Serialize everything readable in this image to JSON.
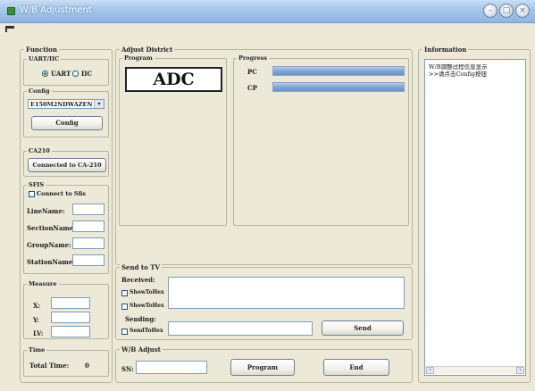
{
  "window": {
    "title": "W/B Adjustment"
  },
  "window_buttons": {
    "minimize": "–",
    "restore": "□",
    "close": "×"
  },
  "function": {
    "legend": "Function",
    "uart_iic": {
      "legend": "UART/IIC",
      "option_uart": "UART",
      "option_iic": "IIC"
    },
    "config": {
      "legend": "Config",
      "combo_value": "E150M2NDWAZEN",
      "button_label": "Config"
    },
    "ca210": {
      "legend": "CA210",
      "button_label": "Connected to CA-210"
    },
    "sfis": {
      "legend": "SFIS",
      "connect_label": "Connect to Sfis",
      "line_name": "LineName:",
      "section_name": "SectionName:",
      "group_name": "GroupName:",
      "station_name": "StationName:"
    },
    "measure": {
      "legend": "Measure",
      "x": "X:",
      "y": "Y:",
      "lv": "LV:"
    },
    "time": {
      "legend": "Time",
      "total_label": "Total Time:",
      "total_value": "0"
    }
  },
  "adjust": {
    "legend": "Adjust District",
    "program": {
      "legend": "Program",
      "display": "ADC"
    },
    "progress": {
      "legend": "Progress",
      "pc_label": "PC",
      "cp_label": "CP",
      "pc_fraction": 1.0,
      "cp_fraction": 1.0
    }
  },
  "send_to_tv": {
    "legend": "Send to TV",
    "received_label": "Received:",
    "show_to_hex": "ShowToHex",
    "show_to_hex2": "ShowToHex",
    "sending_label": "Sending:",
    "send_to_hex": "SendToHex",
    "send_button": "Send"
  },
  "wb_adjust": {
    "legend": "W/B Adjust",
    "sn_label": "SN:",
    "program_button": "Program",
    "end_button": "End"
  },
  "information": {
    "legend": "Information",
    "lines": [
      "W/B調整过程信息显示",
      ">>请点击Config按钮"
    ]
  },
  "colors": {
    "titlebar": "#a7c7ea",
    "progress_fill": "#7fa4d6",
    "window_bg": "#ece9d8"
  }
}
